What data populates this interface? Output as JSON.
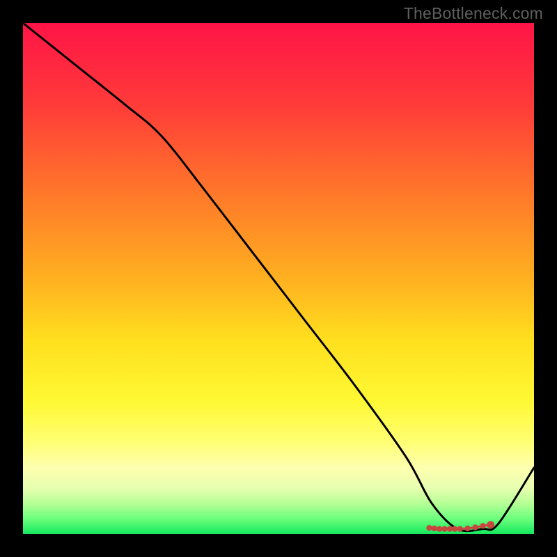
{
  "watermark": {
    "text": "TheBottleneck.com"
  },
  "chart_data": {
    "type": "line",
    "title": "",
    "xlabel": "",
    "ylabel": "",
    "xlim": [
      0,
      100
    ],
    "ylim": [
      0,
      100
    ],
    "grid": false,
    "legend": false,
    "gradient_stops": [
      {
        "pct": 0,
        "color": "#ff1447"
      },
      {
        "pct": 16,
        "color": "#ff3b39"
      },
      {
        "pct": 34,
        "color": "#ff7a29"
      },
      {
        "pct": 50,
        "color": "#ffb020"
      },
      {
        "pct": 62,
        "color": "#ffdf1e"
      },
      {
        "pct": 74,
        "color": "#fff833"
      },
      {
        "pct": 82,
        "color": "#ffff73"
      },
      {
        "pct": 87,
        "color": "#fdffae"
      },
      {
        "pct": 91,
        "color": "#e7ffb0"
      },
      {
        "pct": 94,
        "color": "#b6ff96"
      },
      {
        "pct": 97,
        "color": "#6cff7d"
      },
      {
        "pct": 100,
        "color": "#14e85e"
      }
    ],
    "series": [
      {
        "name": "bottleneck-curve",
        "color": "#000000",
        "x": [
          0,
          10,
          20,
          27,
          35,
          45,
          55,
          65,
          75,
          80,
          85,
          90,
          93,
          100
        ],
        "y": [
          100,
          92,
          84,
          78,
          68,
          55,
          42,
          29,
          15,
          6,
          1,
          1,
          2,
          13
        ]
      }
    ],
    "markers": {
      "name": "optimal-range",
      "color": "#c9463f",
      "style": "dots-with-segments",
      "points_x": [
        79.5,
        80.5,
        81.5,
        82.5,
        83.5,
        84.5,
        85.5,
        87.0,
        88.5,
        90.0,
        91.5
      ],
      "points_y": [
        1.2,
        1.1,
        1.0,
        1.0,
        1.0,
        1.0,
        1.0,
        1.1,
        1.3,
        1.6,
        1.8
      ]
    }
  }
}
